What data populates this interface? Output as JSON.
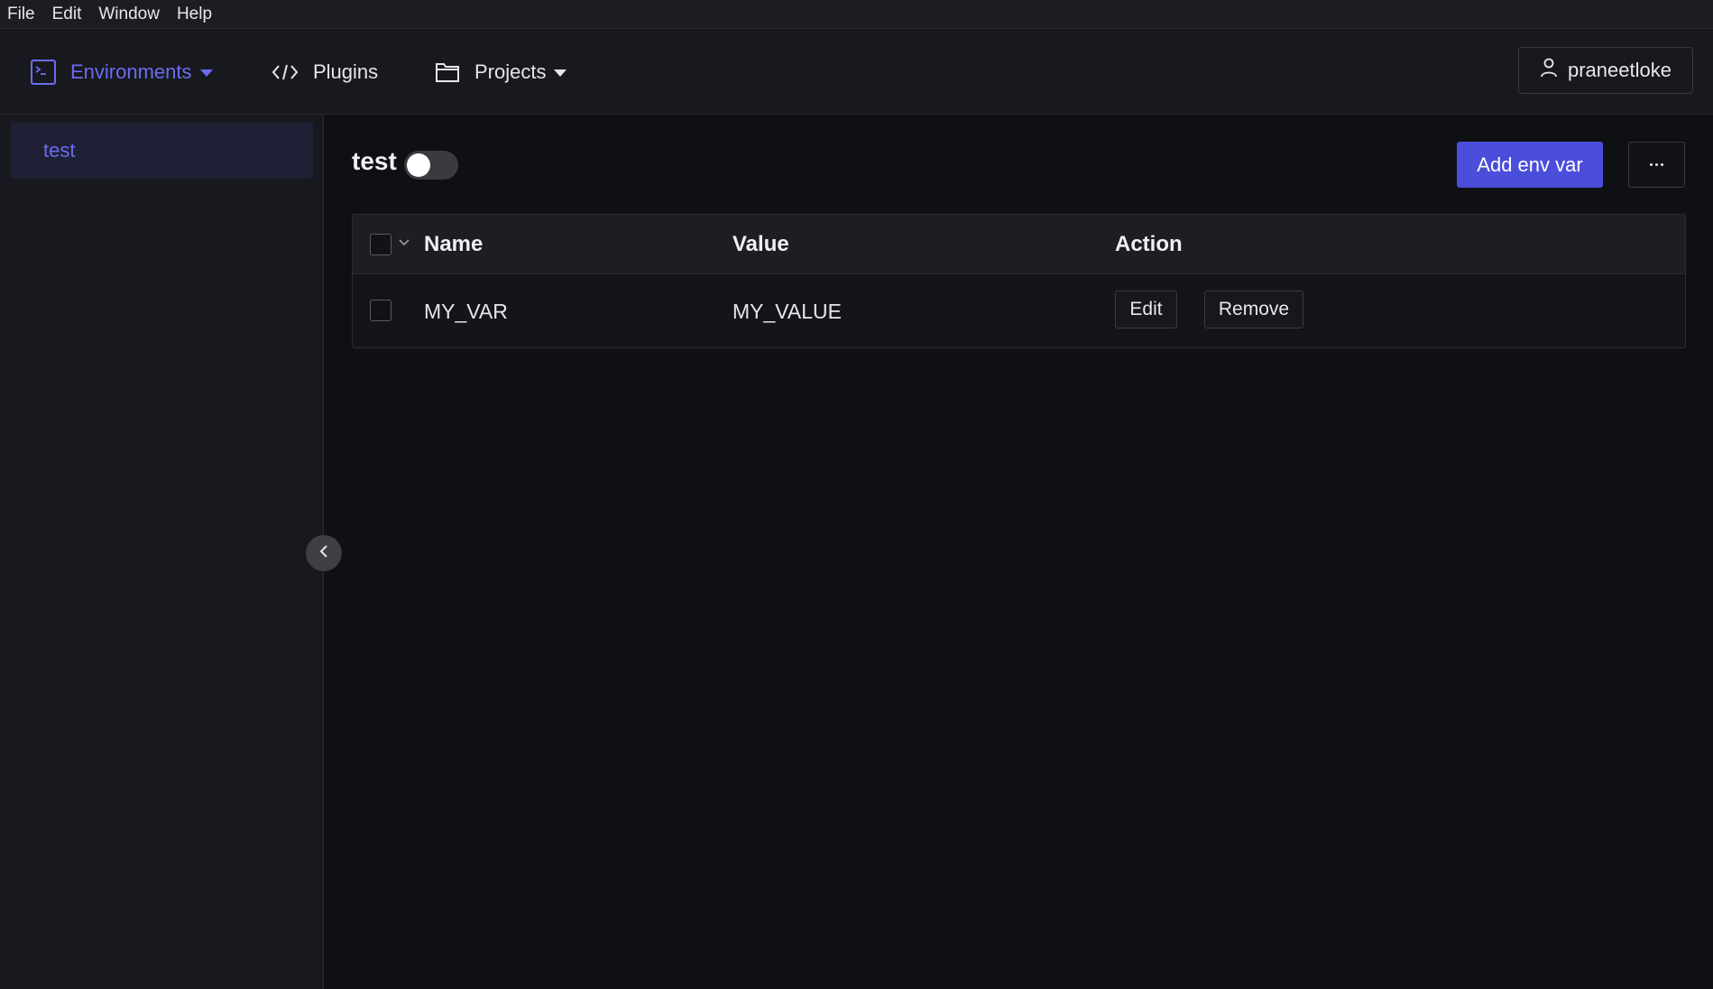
{
  "menubar": {
    "items": [
      {
        "label": "File"
      },
      {
        "label": "Edit"
      },
      {
        "label": "Window"
      },
      {
        "label": "Help"
      }
    ]
  },
  "nav": {
    "environments": {
      "label": "Environments",
      "icon": "terminal-icon"
    },
    "plugins": {
      "label": "Plugins",
      "icon": "code-icon"
    },
    "projects": {
      "label": "Projects",
      "icon": "folder-icon"
    },
    "user": {
      "label": "praneetloke",
      "icon": "user-icon"
    }
  },
  "sidebar": {
    "environments": [
      {
        "label": "test",
        "selected": true
      }
    ]
  },
  "main": {
    "env_name": "test",
    "toggle_on": false,
    "add_button": "Add env var",
    "more_icon": "ellipsis-icon",
    "table": {
      "columns": {
        "name": "Name",
        "value": "Value",
        "action": "Action"
      },
      "rows": [
        {
          "name": "MY_VAR",
          "value": "MY_VALUE",
          "edit": "Edit",
          "remove": "Remove"
        }
      ]
    }
  },
  "colors": {
    "accent": "#4b4ddb",
    "active_nav": "#6b6cf0",
    "background": "#0f1014"
  }
}
